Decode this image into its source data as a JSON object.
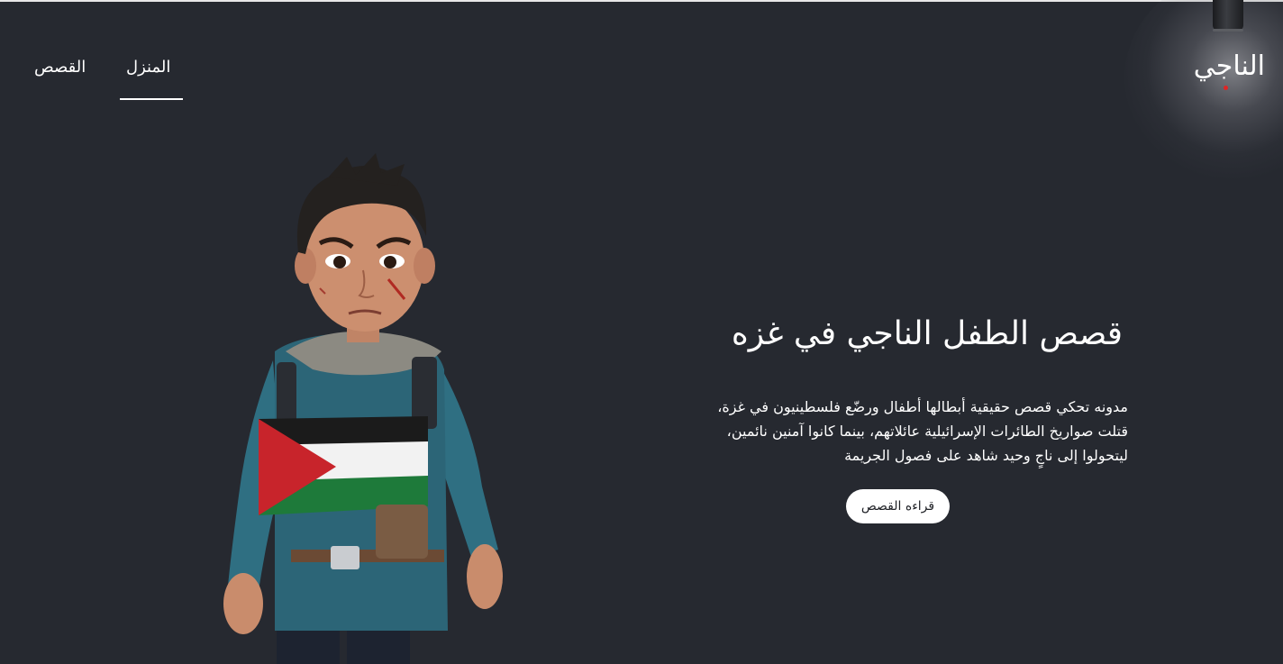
{
  "brand": {
    "logo": "الناجي"
  },
  "nav": {
    "home": "المنزل",
    "stories": "القصص"
  },
  "hero": {
    "title": "قصص الطفل الناجي في غزه",
    "lines": [
      "مدونه تحكي قصص حقيقية أبطالها أطفال ورضّع فلسطينيون في غزة،",
      "قتلت صواريخ الطائرات الإسرائيلية عائلاتهم، بينما كانوا آمنين نائمين،",
      "ليتحولوا إلى ناجٍ وحيد شاهد على فصول الجريمة"
    ],
    "button": "قراءه القصص"
  },
  "colors": {
    "background": "#262930",
    "text": "#ffffff",
    "button_bg": "#ffffff",
    "flag_red": "#c8242b",
    "flag_green": "#1e7a3a"
  }
}
